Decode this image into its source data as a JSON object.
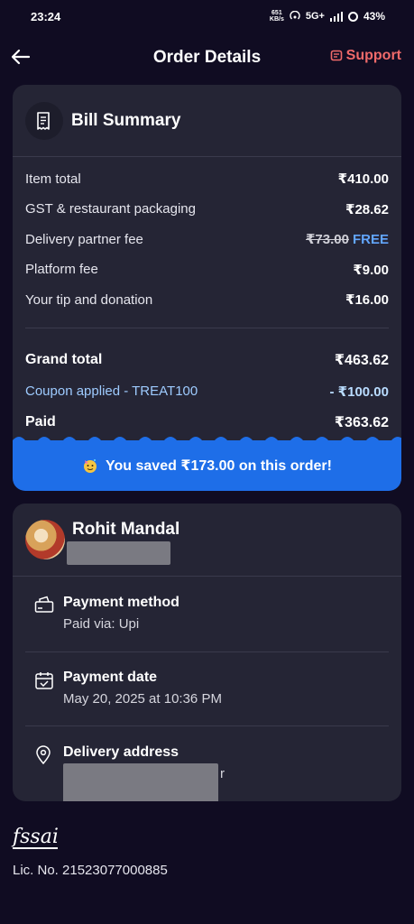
{
  "status": {
    "time": "23:24",
    "speed": "651",
    "speed_unit": "KB/s",
    "network": "5G+",
    "battery": "43%"
  },
  "header": {
    "title": "Order Details",
    "support_label": "Support"
  },
  "bill": {
    "title": "Bill Summary",
    "rows": [
      {
        "label": "Item total",
        "value": "₹410.00"
      },
      {
        "label": "GST & restaurant packaging",
        "value": "₹28.62"
      },
      {
        "label": "Delivery partner fee",
        "original": "₹73.00",
        "value": "FREE"
      },
      {
        "label": "Platform fee",
        "value": "₹9.00"
      },
      {
        "label": "Your tip and donation",
        "value": "₹16.00"
      }
    ],
    "grand_total": {
      "label": "Grand total",
      "value": "₹463.62"
    },
    "coupon": {
      "label": "Coupon applied - TREAT100",
      "value": "- ₹100.00"
    },
    "paid": {
      "label": "Paid",
      "value": "₹363.62"
    },
    "savings": "You saved ₹173.00 on this order!"
  },
  "customer": {
    "name": "Rohit Mandal"
  },
  "payment_method": {
    "title": "Payment method",
    "value": "Paid via: Upi"
  },
  "payment_date": {
    "title": "Payment date",
    "value": "May 20, 2025 at 10:36 PM"
  },
  "delivery_address": {
    "title": "Delivery address",
    "tail": "r"
  },
  "footer": {
    "fssai": "fssai",
    "license": "Lic. No. 21523077000885"
  },
  "colors": {
    "background": "#100c22",
    "card": "#252535",
    "accent_red": "#f06a6a",
    "savings_blue": "#1e6ee8",
    "free_blue": "#62a6ff"
  }
}
